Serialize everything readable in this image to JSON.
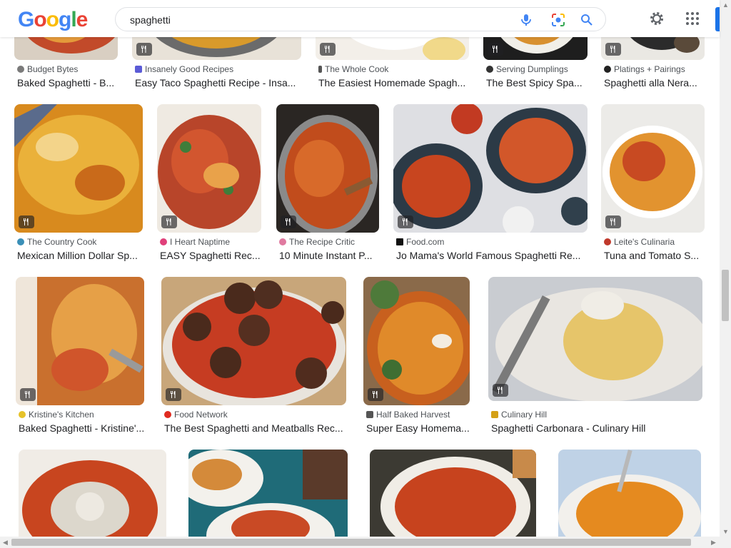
{
  "search": {
    "query": "spaghetti",
    "logo": "Google"
  },
  "results": [
    {
      "source": "Budget Bytes",
      "title": "Baked Spaghetti - B...",
      "fav": "#7a7a7a"
    },
    {
      "source": "Insanely Good Recipes",
      "title": "Easy Taco Spaghetti Recipe - Insa...",
      "fav": "#5b5bd6"
    },
    {
      "source": "The Whole Cook",
      "title": "The Easiest Homemade Spagh...",
      "fav": "#555555"
    },
    {
      "source": "Serving Dumplings",
      "title": "The Best Spicy Spa...",
      "fav": "#333333"
    },
    {
      "source": "Platings + Pairings",
      "title": "Spaghetti alla Nera...",
      "fav": "#222222"
    },
    {
      "source": "The Country Cook",
      "title": "Mexican Million Dollar Sp...",
      "fav": "#3a8fb7"
    },
    {
      "source": "I Heart Naptime",
      "title": "EASY Spaghetti Rec...",
      "fav": "#e0407a"
    },
    {
      "source": "The Recipe Critic",
      "title": "10 Minute Instant P...",
      "fav": "#e07aa0"
    },
    {
      "source": "Food.com",
      "title": "Jo Mama's World Famous Spaghetti Re...",
      "fav": "#111111"
    },
    {
      "source": "Leite's Culinaria",
      "title": "Tuna and Tomato S...",
      "fav": "#c0392b"
    },
    {
      "source": "Kristine's Kitchen",
      "title": "Baked Spaghetti - Kristine'...",
      "fav": "#e6c229"
    },
    {
      "source": "Food Network",
      "title": "The Best Spaghetti and Meatballs Rec...",
      "fav": "#e02b20"
    },
    {
      "source": "Half Baked Harvest",
      "title": "Super Easy Homema...",
      "fav": "#555555"
    },
    {
      "source": "Culinary Hill",
      "title": "Spaghetti Carbonara - Culinary Hill",
      "fav": "#d4a017"
    }
  ]
}
